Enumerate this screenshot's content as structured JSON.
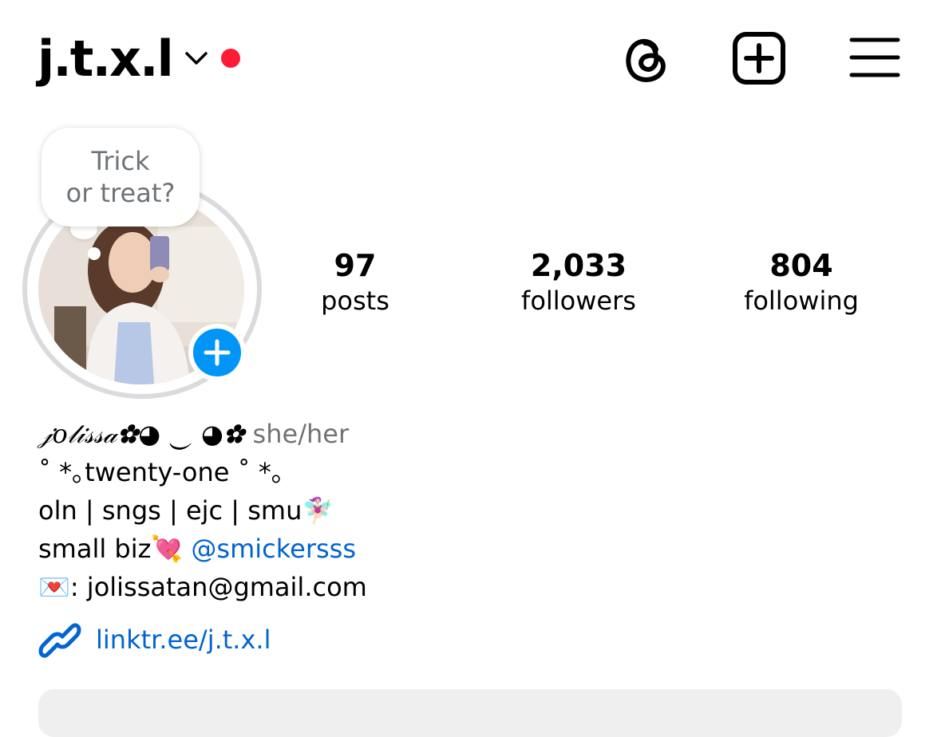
{
  "header": {
    "username": "j.t.x.l",
    "icons": [
      "chevron-down-icon",
      "notification-dot",
      "threads-icon",
      "create-post-icon",
      "menu-icon"
    ],
    "notification_color": "#ff1a35"
  },
  "note": {
    "line1": "Trick",
    "line2": "or treat?"
  },
  "stats": {
    "posts": {
      "count": "97",
      "label": "posts"
    },
    "followers": {
      "count": "2,033",
      "label": "followers"
    },
    "following": {
      "count": "804",
      "label": "following"
    }
  },
  "bio": {
    "display_name": "𝒿𝑜𝓁𝒾𝓈𝓈𝒶✿◕ ‿ ◕✿",
    "pronouns": "she/her",
    "line2": "˚ *｡twenty-one ˚ *｡",
    "line3": "oln | sngs | ejc | smu🧚🏻‍♀️",
    "line4_prefix": "small biz💘 ",
    "line4_mention": "@smickersss",
    "line5": "💌: jolissatan@gmail.com"
  },
  "link": {
    "text": "linktr.ee/j.t.x.l"
  },
  "colors": {
    "accent_blue": "#0095f6",
    "link_blue": "#0064d1",
    "muted": "#737373"
  }
}
